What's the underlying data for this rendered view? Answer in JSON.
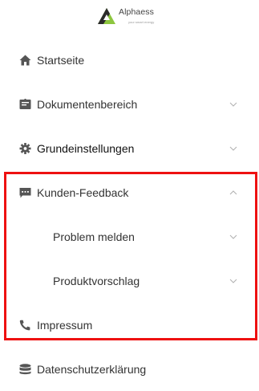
{
  "brand": {
    "name": "Alphaess",
    "tagline": "your smart energy"
  },
  "nav": {
    "home": "Startseite",
    "documents": "Dokumentenbereich",
    "settings": "Grundeinstellungen",
    "feedback": "Kunden-Feedback",
    "report_problem": "Problem melden",
    "product_suggestion": "Produktvorschlag",
    "imprint": "Impressum",
    "privacy": "Datenschutzerklärung"
  },
  "icons": {
    "home": "home-icon",
    "documents": "document-icon",
    "settings": "gear-icon",
    "feedback": "chat-icon",
    "imprint": "phone-icon",
    "privacy": "database-icon"
  },
  "colors": {
    "brand_green": "#8dc63f",
    "brand_dark": "#333333",
    "highlight": "#ee1111",
    "icon": "#555555",
    "chevron": "#b0b0b0"
  },
  "state": {
    "expanded_section": "Kunden-Feedback"
  }
}
